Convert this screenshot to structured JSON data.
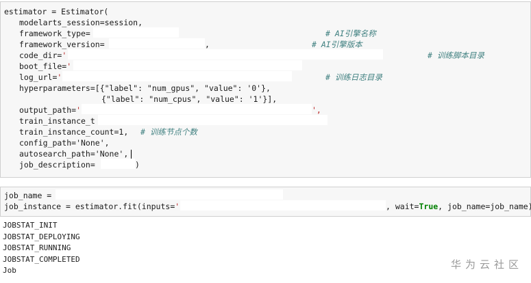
{
  "cell1": {
    "line1": "estimator = Estimator(",
    "line2": "modelarts_session=session,",
    "line3_key": "framework_type=",
    "line3_comment": "# AI引擎名称",
    "line4_key": "framework_version=",
    "line4_tail": ",",
    "line4_comment": "# AI引擎版本",
    "line5_key": "code_dir=",
    "line5_q": "'",
    "line5_comment": "# 训练脚本目录",
    "line6_key": "boot_file=",
    "line6_q": "'",
    "line7_key": "log_url=",
    "line7_q": "'",
    "line7_comment": "# 训练日志目录",
    "line8": "hyperparameters=[{\"label\": \"num_gpus\", \"value\": '0'},",
    "line9": "{\"label\": \"num_cpus\", \"value\": '1'}],",
    "line10_key": "output_path=",
    "line10_q": "'",
    "line10_tail": "',",
    "line11_key": "train_instance_t",
    "line12_key": "train_instance_count=1,",
    "line12_comment": "# 训练节点个数",
    "line13": "config_path='None',",
    "line14": "autosearch_path='None',",
    "line15_key": "job_description=",
    "line15_tail": ")"
  },
  "cell2": {
    "line1": "job_name =",
    "line2_a": "job_instance = estimator.fit(inputs=",
    "line2_q": "'",
    "line2_b": ", wait=",
    "line2_true": "True",
    "line2_c": ", job_name=job_name)"
  },
  "output": {
    "lines": [
      "JOBSTAT_INIT",
      "JOBSTAT_DEPLOYING",
      "JOBSTAT_RUNNING",
      "JOBSTAT_COMPLETED",
      "Job"
    ]
  },
  "watermark": "华为云社区"
}
